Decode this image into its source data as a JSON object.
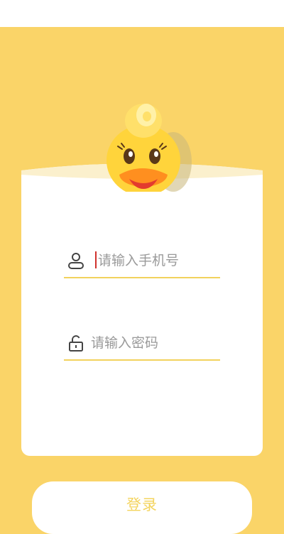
{
  "form": {
    "phone_placeholder": "请输入手机号",
    "phone_value": "",
    "password_placeholder": "请输入密码",
    "password_value": ""
  },
  "actions": {
    "login_label": "登录"
  },
  "icons": {
    "phone_field": "user-icon",
    "password_field": "lock-icon",
    "mascot": "duck-mascot"
  },
  "colors": {
    "background": "#fad468",
    "accent": "#f4d45e",
    "card": "#ffffff",
    "placeholder": "#9a9a9a",
    "cursor": "#d0312d"
  }
}
